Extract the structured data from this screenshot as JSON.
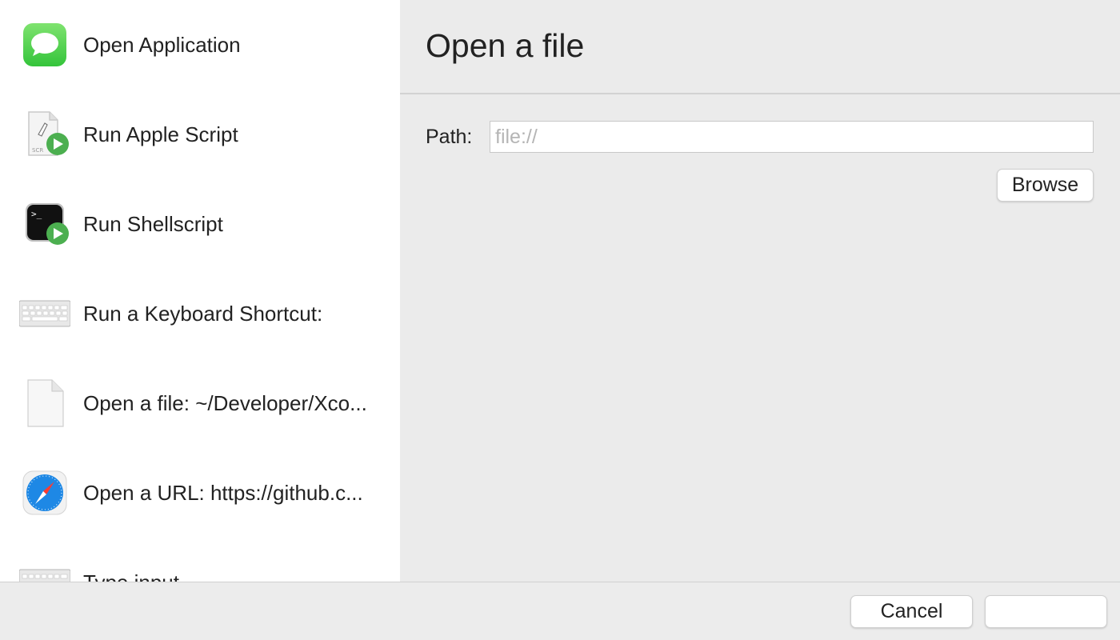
{
  "sidebar": {
    "items": [
      {
        "label": "Open Application",
        "icon": "messages-app-icon"
      },
      {
        "label": "Run Apple Script",
        "icon": "script-editor-icon"
      },
      {
        "label": "Run Shellscript",
        "icon": "terminal-icon"
      },
      {
        "label": "Run a Keyboard Shortcut:",
        "icon": "keyboard-icon"
      },
      {
        "label": "Open a file: ~/Developer/Xco...",
        "icon": "document-icon"
      },
      {
        "label": "Open a URL: https://github.c...",
        "icon": "safari-icon"
      },
      {
        "label": "Type input",
        "icon": "keyboard-icon"
      }
    ]
  },
  "panel": {
    "title": "Open a file",
    "path_label": "Path:",
    "path_value": "",
    "path_placeholder": "file://",
    "browse_label": "Browse"
  },
  "footer": {
    "cancel_label": "Cancel",
    "confirm_label": ""
  },
  "colors": {
    "sidebar_bg": "#ffffff",
    "panel_bg": "#ebebeb",
    "messages_green": "#5fd35a",
    "play_green": "#4caf50",
    "safari_blue": "#1e88e5"
  }
}
